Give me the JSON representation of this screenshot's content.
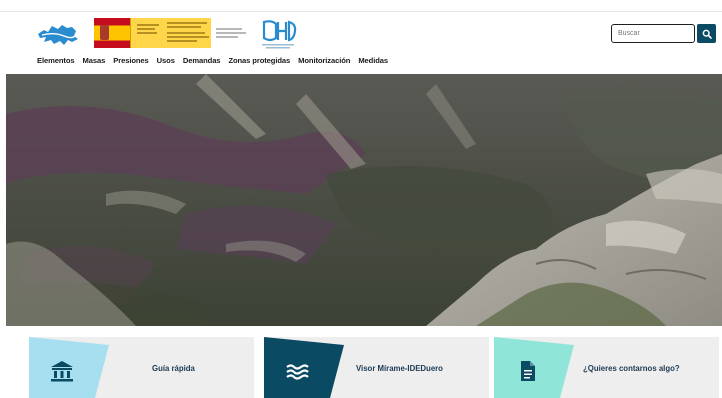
{
  "search": {
    "placeholder": "Buscar"
  },
  "nav": {
    "items": [
      "Elementos",
      "Masas",
      "Presiones",
      "Usos",
      "Demandas",
      "Zonas protegidas",
      "Monitorización",
      "Medidas"
    ]
  },
  "cards": [
    {
      "label": "Guía rápida",
      "icon": "bank-icon",
      "accent": "#a7dff0"
    },
    {
      "label": "Visor Mírame-IDEDuero",
      "icon": "waves-icon",
      "accent": "#0b4a63"
    },
    {
      "label": "¿Quieres contarnos algo?",
      "icon": "document-icon",
      "accent": "#8fe6d8"
    }
  ],
  "colors": {
    "brand_dark": "#0b4a63",
    "brand_light": "#a7dff0",
    "brand_teal": "#8fe6d8",
    "logo_blue": "#2a8ccf"
  }
}
